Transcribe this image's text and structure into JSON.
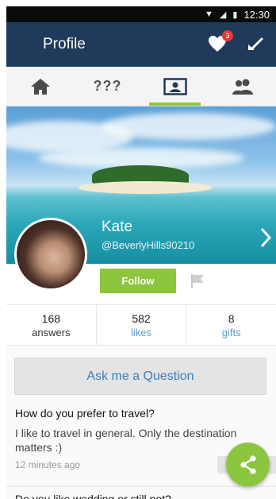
{
  "status_bar": {
    "time": "12:30"
  },
  "header": {
    "title": "Profile",
    "notification_count": "3",
    "icons": [
      "heart-icon",
      "back-arrow-icon"
    ]
  },
  "tabs": [
    {
      "icon": "home-icon",
      "label": ""
    },
    {
      "icon": "",
      "label": "???"
    },
    {
      "icon": "profile-card-icon",
      "label": "",
      "active": true
    },
    {
      "icon": "people-icon",
      "label": ""
    }
  ],
  "profile": {
    "name": "Kate",
    "handle": "@BeverlyHills90210",
    "follow_label": "Follow"
  },
  "stats": [
    {
      "value": "168",
      "label": "answers"
    },
    {
      "value": "582",
      "label": "likes"
    },
    {
      "value": "8",
      "label": "gifts"
    }
  ],
  "ask_label": "Ask me a Question",
  "feed": {
    "question": "How do you prefer to travel?",
    "answer": "I like to travel in general. Only the destination matters :)",
    "time": "12 minutes ago",
    "next_question": "Do you like wedding or still not?"
  },
  "colors": {
    "app_bar": "#1f3a5a",
    "accent_green": "#8cc63f",
    "link_blue": "#3f7fb7",
    "badge_red": "#e53935"
  }
}
